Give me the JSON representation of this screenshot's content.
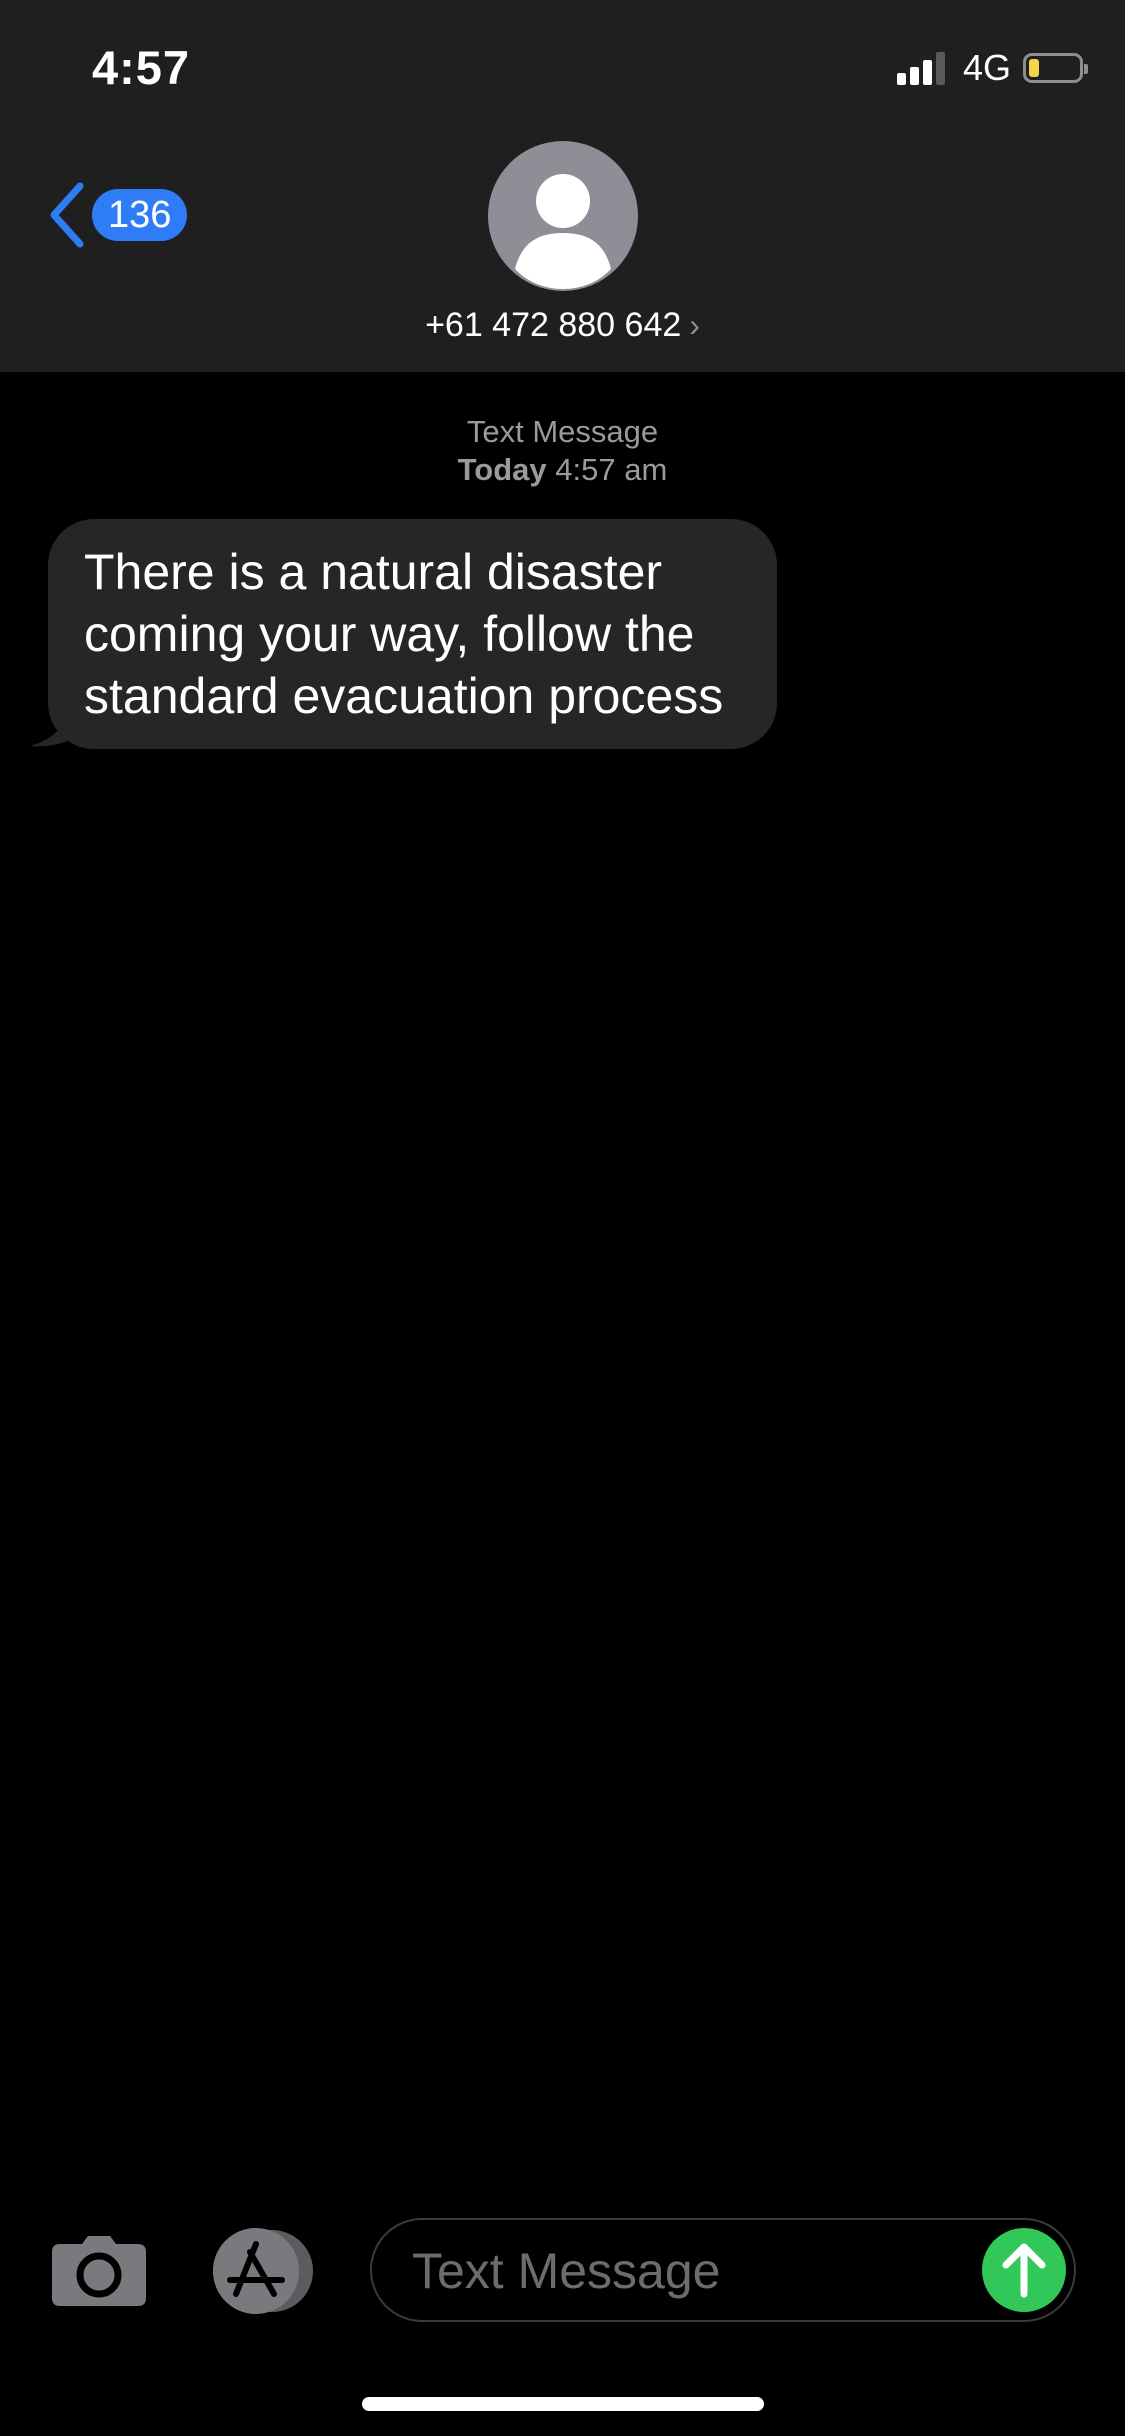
{
  "status_bar": {
    "time": "4:57",
    "network": "4G",
    "signal_bars_active": 3,
    "signal_bars_total": 4,
    "battery_level": 0.2,
    "battery_color": "#f6d34a",
    "signal_icon": "cellular-signal-icon",
    "battery_icon": "battery-icon"
  },
  "nav": {
    "back_count": "136",
    "back_icon": "chevron-left-icon",
    "accent_color": "#2f7df6",
    "avatar_icon": "person-silhouette-icon",
    "contact": "+61 472 880 642",
    "contact_chevron": "›"
  },
  "conversation": {
    "service": "Text Message",
    "day": "Today",
    "time": "4:57 am",
    "messages": [
      {
        "direction": "incoming",
        "text": "There is a natural disaster coming your way, follow the standard evacuation process"
      }
    ]
  },
  "composer": {
    "camera_icon": "camera-icon",
    "apps_icon": "app-store-icon",
    "placeholder": "Text Message",
    "value": "",
    "send_icon": "arrow-up-icon",
    "send_color": "#31c759"
  }
}
